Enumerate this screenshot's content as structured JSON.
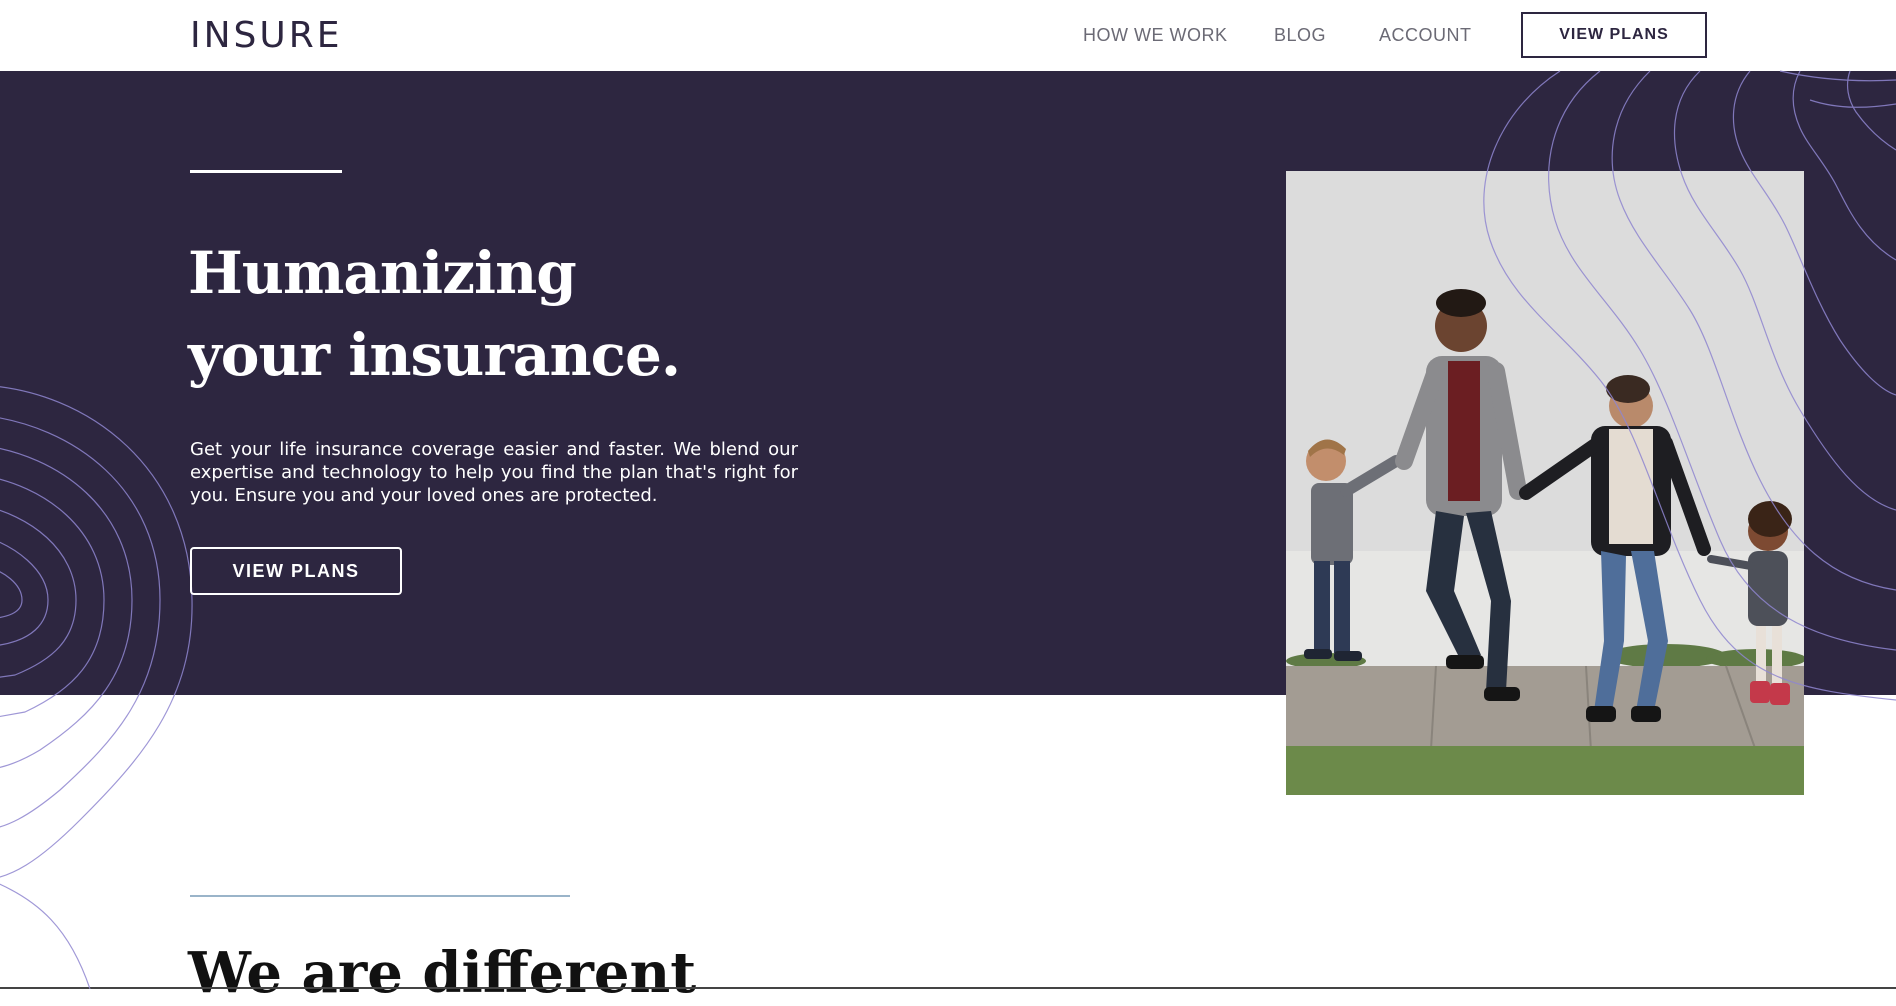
{
  "header": {
    "logo": "INSURE",
    "nav": [
      {
        "label": "HOW WE WORK"
      },
      {
        "label": "BLOG"
      },
      {
        "label": "ACCOUNT"
      }
    ],
    "cta_label": "VIEW PLANS"
  },
  "hero": {
    "title_line1": "Humanizing",
    "title_line2": "your insurance.",
    "description": "Get your life insurance coverage easier and faster. We blend our expertise and technology to help you find the plan that's right for you. Ensure you and your loved ones are protected.",
    "cta_label": "VIEW PLANS",
    "image_subject": "family-walking-holding-hands-photo"
  },
  "section": {
    "title": "We are different"
  },
  "colors": {
    "primary_dark": "#2d2640",
    "accent_line": "#9ab4c9",
    "white": "#ffffff",
    "nav_text": "#6b6a75"
  }
}
